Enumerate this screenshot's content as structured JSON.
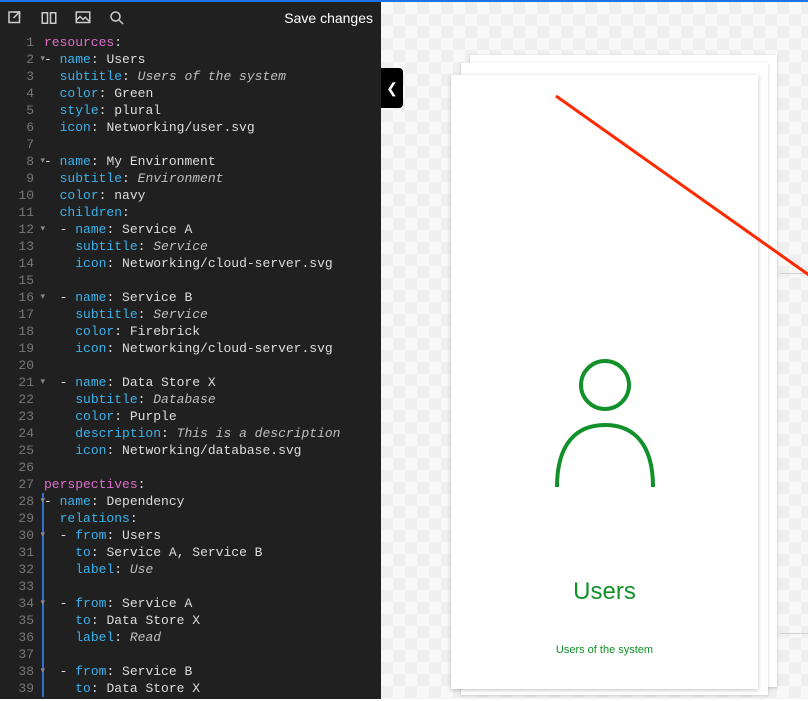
{
  "toolbar": {
    "save_label": "Save changes"
  },
  "code": {
    "lines": [
      {
        "n": "1",
        "fold": false,
        "chg": false,
        "seg": [
          [
            "sect",
            "resources"
          ],
          [
            "kc",
            ":"
          ]
        ]
      },
      {
        "n": "2",
        "fold": true,
        "chg": false,
        "seg": [
          [
            "kc",
            "- "
          ],
          [
            "key",
            "name"
          ],
          [
            "kc",
            ": "
          ],
          [
            "pl",
            "Users"
          ]
        ]
      },
      {
        "n": "3",
        "fold": false,
        "chg": false,
        "seg": [
          [
            "kc",
            "  "
          ],
          [
            "key",
            "subtitle"
          ],
          [
            "kc",
            ": "
          ],
          [
            "it",
            "Users of the system"
          ]
        ]
      },
      {
        "n": "4",
        "fold": false,
        "chg": false,
        "seg": [
          [
            "kc",
            "  "
          ],
          [
            "key",
            "color"
          ],
          [
            "kc",
            ": "
          ],
          [
            "pl",
            "Green"
          ]
        ]
      },
      {
        "n": "5",
        "fold": false,
        "chg": false,
        "seg": [
          [
            "kc",
            "  "
          ],
          [
            "key",
            "style"
          ],
          [
            "kc",
            ": "
          ],
          [
            "pl",
            "plural"
          ]
        ]
      },
      {
        "n": "6",
        "fold": false,
        "chg": false,
        "seg": [
          [
            "kc",
            "  "
          ],
          [
            "key",
            "icon"
          ],
          [
            "kc",
            ": "
          ],
          [
            "pl",
            "Networking/user.svg"
          ]
        ]
      },
      {
        "n": "7",
        "fold": false,
        "chg": false,
        "seg": []
      },
      {
        "n": "8",
        "fold": true,
        "chg": false,
        "seg": [
          [
            "kc",
            "- "
          ],
          [
            "key",
            "name"
          ],
          [
            "kc",
            ": "
          ],
          [
            "pl",
            "My Environment"
          ]
        ]
      },
      {
        "n": "9",
        "fold": false,
        "chg": false,
        "seg": [
          [
            "kc",
            "  "
          ],
          [
            "key",
            "subtitle"
          ],
          [
            "kc",
            ": "
          ],
          [
            "it",
            "Environment"
          ]
        ]
      },
      {
        "n": "10",
        "fold": false,
        "chg": false,
        "seg": [
          [
            "kc",
            "  "
          ],
          [
            "key",
            "color"
          ],
          [
            "kc",
            ": "
          ],
          [
            "pl",
            "navy"
          ]
        ]
      },
      {
        "n": "11",
        "fold": false,
        "chg": false,
        "seg": [
          [
            "kc",
            "  "
          ],
          [
            "key",
            "children"
          ],
          [
            "kc",
            ":"
          ]
        ]
      },
      {
        "n": "12",
        "fold": true,
        "chg": false,
        "seg": [
          [
            "kc",
            "  - "
          ],
          [
            "key",
            "name"
          ],
          [
            "kc",
            ": "
          ],
          [
            "pl",
            "Service A"
          ]
        ]
      },
      {
        "n": "13",
        "fold": false,
        "chg": false,
        "seg": [
          [
            "kc",
            "    "
          ],
          [
            "key",
            "subtitle"
          ],
          [
            "kc",
            ": "
          ],
          [
            "it",
            "Service"
          ]
        ]
      },
      {
        "n": "14",
        "fold": false,
        "chg": false,
        "seg": [
          [
            "kc",
            "    "
          ],
          [
            "key",
            "icon"
          ],
          [
            "kc",
            ": "
          ],
          [
            "pl",
            "Networking/cloud-server.svg"
          ]
        ]
      },
      {
        "n": "15",
        "fold": false,
        "chg": false,
        "seg": []
      },
      {
        "n": "16",
        "fold": true,
        "chg": false,
        "seg": [
          [
            "kc",
            "  - "
          ],
          [
            "key",
            "name"
          ],
          [
            "kc",
            ": "
          ],
          [
            "pl",
            "Service B"
          ]
        ]
      },
      {
        "n": "17",
        "fold": false,
        "chg": false,
        "seg": [
          [
            "kc",
            "    "
          ],
          [
            "key",
            "subtitle"
          ],
          [
            "kc",
            ": "
          ],
          [
            "it",
            "Service"
          ]
        ]
      },
      {
        "n": "18",
        "fold": false,
        "chg": false,
        "seg": [
          [
            "kc",
            "    "
          ],
          [
            "key",
            "color"
          ],
          [
            "kc",
            ": "
          ],
          [
            "pl",
            "Firebrick"
          ]
        ]
      },
      {
        "n": "19",
        "fold": false,
        "chg": false,
        "seg": [
          [
            "kc",
            "    "
          ],
          [
            "key",
            "icon"
          ],
          [
            "kc",
            ": "
          ],
          [
            "pl",
            "Networking/cloud-server.svg"
          ]
        ]
      },
      {
        "n": "20",
        "fold": false,
        "chg": false,
        "seg": []
      },
      {
        "n": "21",
        "fold": true,
        "chg": false,
        "seg": [
          [
            "kc",
            "  - "
          ],
          [
            "key",
            "name"
          ],
          [
            "kc",
            ": "
          ],
          [
            "pl",
            "Data Store X"
          ]
        ]
      },
      {
        "n": "22",
        "fold": false,
        "chg": false,
        "seg": [
          [
            "kc",
            "    "
          ],
          [
            "key",
            "subtitle"
          ],
          [
            "kc",
            ": "
          ],
          [
            "it",
            "Database"
          ]
        ]
      },
      {
        "n": "23",
        "fold": false,
        "chg": false,
        "seg": [
          [
            "kc",
            "    "
          ],
          [
            "key",
            "color"
          ],
          [
            "kc",
            ": "
          ],
          [
            "pl",
            "Purple"
          ]
        ]
      },
      {
        "n": "24",
        "fold": false,
        "chg": false,
        "seg": [
          [
            "kc",
            "    "
          ],
          [
            "key",
            "description"
          ],
          [
            "kc",
            ": "
          ],
          [
            "it",
            "This is a description"
          ]
        ]
      },
      {
        "n": "25",
        "fold": false,
        "chg": false,
        "seg": [
          [
            "kc",
            "    "
          ],
          [
            "key",
            "icon"
          ],
          [
            "kc",
            ": "
          ],
          [
            "pl",
            "Networking/database.svg"
          ]
        ]
      },
      {
        "n": "26",
        "fold": false,
        "chg": false,
        "seg": []
      },
      {
        "n": "27",
        "fold": false,
        "chg": false,
        "seg": [
          [
            "sect",
            "perspectives"
          ],
          [
            "kc",
            ":"
          ]
        ]
      },
      {
        "n": "28",
        "fold": true,
        "chg": true,
        "seg": [
          [
            "kc",
            "- "
          ],
          [
            "key",
            "name"
          ],
          [
            "kc",
            ": "
          ],
          [
            "pl",
            "Dependency"
          ]
        ]
      },
      {
        "n": "29",
        "fold": false,
        "chg": true,
        "seg": [
          [
            "kc",
            "  "
          ],
          [
            "key",
            "relations"
          ],
          [
            "kc",
            ":"
          ]
        ]
      },
      {
        "n": "30",
        "fold": true,
        "chg": true,
        "seg": [
          [
            "kc",
            "  - "
          ],
          [
            "key",
            "from"
          ],
          [
            "kc",
            ": "
          ],
          [
            "pl",
            "Users"
          ]
        ]
      },
      {
        "n": "31",
        "fold": false,
        "chg": true,
        "seg": [
          [
            "kc",
            "    "
          ],
          [
            "key",
            "to"
          ],
          [
            "kc",
            ": "
          ],
          [
            "pl",
            "Service A"
          ],
          [
            "kc",
            ", "
          ],
          [
            "pl",
            "Service B"
          ]
        ]
      },
      {
        "n": "32",
        "fold": false,
        "chg": true,
        "seg": [
          [
            "kc",
            "    "
          ],
          [
            "key",
            "label"
          ],
          [
            "kc",
            ": "
          ],
          [
            "it",
            "Use"
          ]
        ]
      },
      {
        "n": "33",
        "fold": false,
        "chg": true,
        "seg": []
      },
      {
        "n": "34",
        "fold": true,
        "chg": true,
        "seg": [
          [
            "kc",
            "  - "
          ],
          [
            "key",
            "from"
          ],
          [
            "kc",
            ": "
          ],
          [
            "pl",
            "Service A"
          ]
        ]
      },
      {
        "n": "35",
        "fold": false,
        "chg": true,
        "seg": [
          [
            "kc",
            "    "
          ],
          [
            "key",
            "to"
          ],
          [
            "kc",
            ": "
          ],
          [
            "pl",
            "Data Store X"
          ]
        ]
      },
      {
        "n": "36",
        "fold": false,
        "chg": true,
        "seg": [
          [
            "kc",
            "    "
          ],
          [
            "key",
            "label"
          ],
          [
            "kc",
            ": "
          ],
          [
            "it",
            "Read"
          ]
        ]
      },
      {
        "n": "37",
        "fold": false,
        "chg": true,
        "seg": []
      },
      {
        "n": "38",
        "fold": true,
        "chg": true,
        "seg": [
          [
            "kc",
            "  - "
          ],
          [
            "key",
            "from"
          ],
          [
            "kc",
            ": "
          ],
          [
            "pl",
            "Service B"
          ]
        ]
      },
      {
        "n": "39",
        "fold": false,
        "chg": true,
        "seg": [
          [
            "kc",
            "    "
          ],
          [
            "key",
            "to"
          ],
          [
            "kc",
            ": "
          ],
          [
            "pl",
            "Data Store X"
          ]
        ]
      }
    ]
  },
  "card": {
    "title": "Users",
    "subtitle": "Users of the system",
    "color": "#12902a"
  }
}
